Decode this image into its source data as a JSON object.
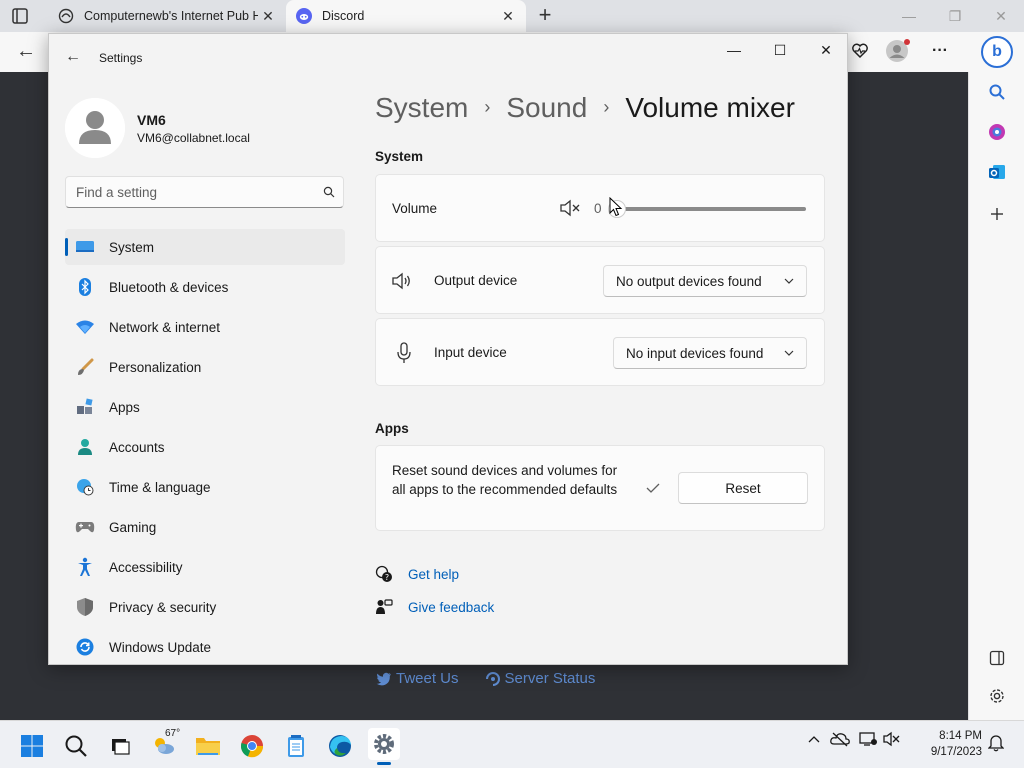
{
  "browser": {
    "tabs": [
      {
        "title": "Computernewb's Internet Pub Hub",
        "close": "✕"
      },
      {
        "title": "Discord",
        "close": "✕"
      }
    ],
    "new_tab": "+",
    "controls": {
      "minimize": "—",
      "restore": "❐",
      "close": "✕"
    },
    "nav": {
      "back": "←",
      "more": "···"
    }
  },
  "web_page": {
    "footer_links": [
      "Tweet Us",
      "Server Status"
    ]
  },
  "settings": {
    "window_title": "Settings",
    "back": "←",
    "controls": {
      "minimize": "—",
      "maximize": "☐",
      "close": "✕"
    },
    "user": {
      "name": "VM6",
      "email": "VM6@collabnet.local"
    },
    "search": {
      "placeholder": "Find a setting"
    },
    "nav_items": [
      {
        "label": "System",
        "icon": "system-icon",
        "selected": true
      },
      {
        "label": "Bluetooth & devices",
        "icon": "bluetooth-icon"
      },
      {
        "label": "Network & internet",
        "icon": "wifi-icon"
      },
      {
        "label": "Personalization",
        "icon": "brush-icon"
      },
      {
        "label": "Apps",
        "icon": "apps-icon"
      },
      {
        "label": "Accounts",
        "icon": "person-icon"
      },
      {
        "label": "Time & language",
        "icon": "globe-clock-icon"
      },
      {
        "label": "Gaming",
        "icon": "gamepad-icon"
      },
      {
        "label": "Accessibility",
        "icon": "accessibility-icon"
      },
      {
        "label": "Privacy & security",
        "icon": "shield-icon"
      },
      {
        "label": "Windows Update",
        "icon": "update-icon"
      }
    ],
    "breadcrumb": {
      "items": [
        "System",
        "Sound"
      ],
      "current": "Volume mixer",
      "separator": "›"
    },
    "system_section": {
      "heading": "System",
      "volume": {
        "label": "Volume",
        "value": "0",
        "level_percent": 0
      },
      "output": {
        "label": "Output device",
        "value": "No output devices found"
      },
      "input": {
        "label": "Input device",
        "value": "No input devices found"
      }
    },
    "apps_section": {
      "heading": "Apps",
      "reset_text": "Reset sound devices and volumes for all apps to the recommended defaults",
      "reset_button": "Reset"
    },
    "links": {
      "help": "Get help",
      "feedback": "Give feedback"
    }
  },
  "taskbar": {
    "weather_temp": "67°",
    "time": "8:14 PM",
    "date": "9/17/2023"
  },
  "colors": {
    "accent": "#005fb8",
    "discord": "#5865f2"
  }
}
